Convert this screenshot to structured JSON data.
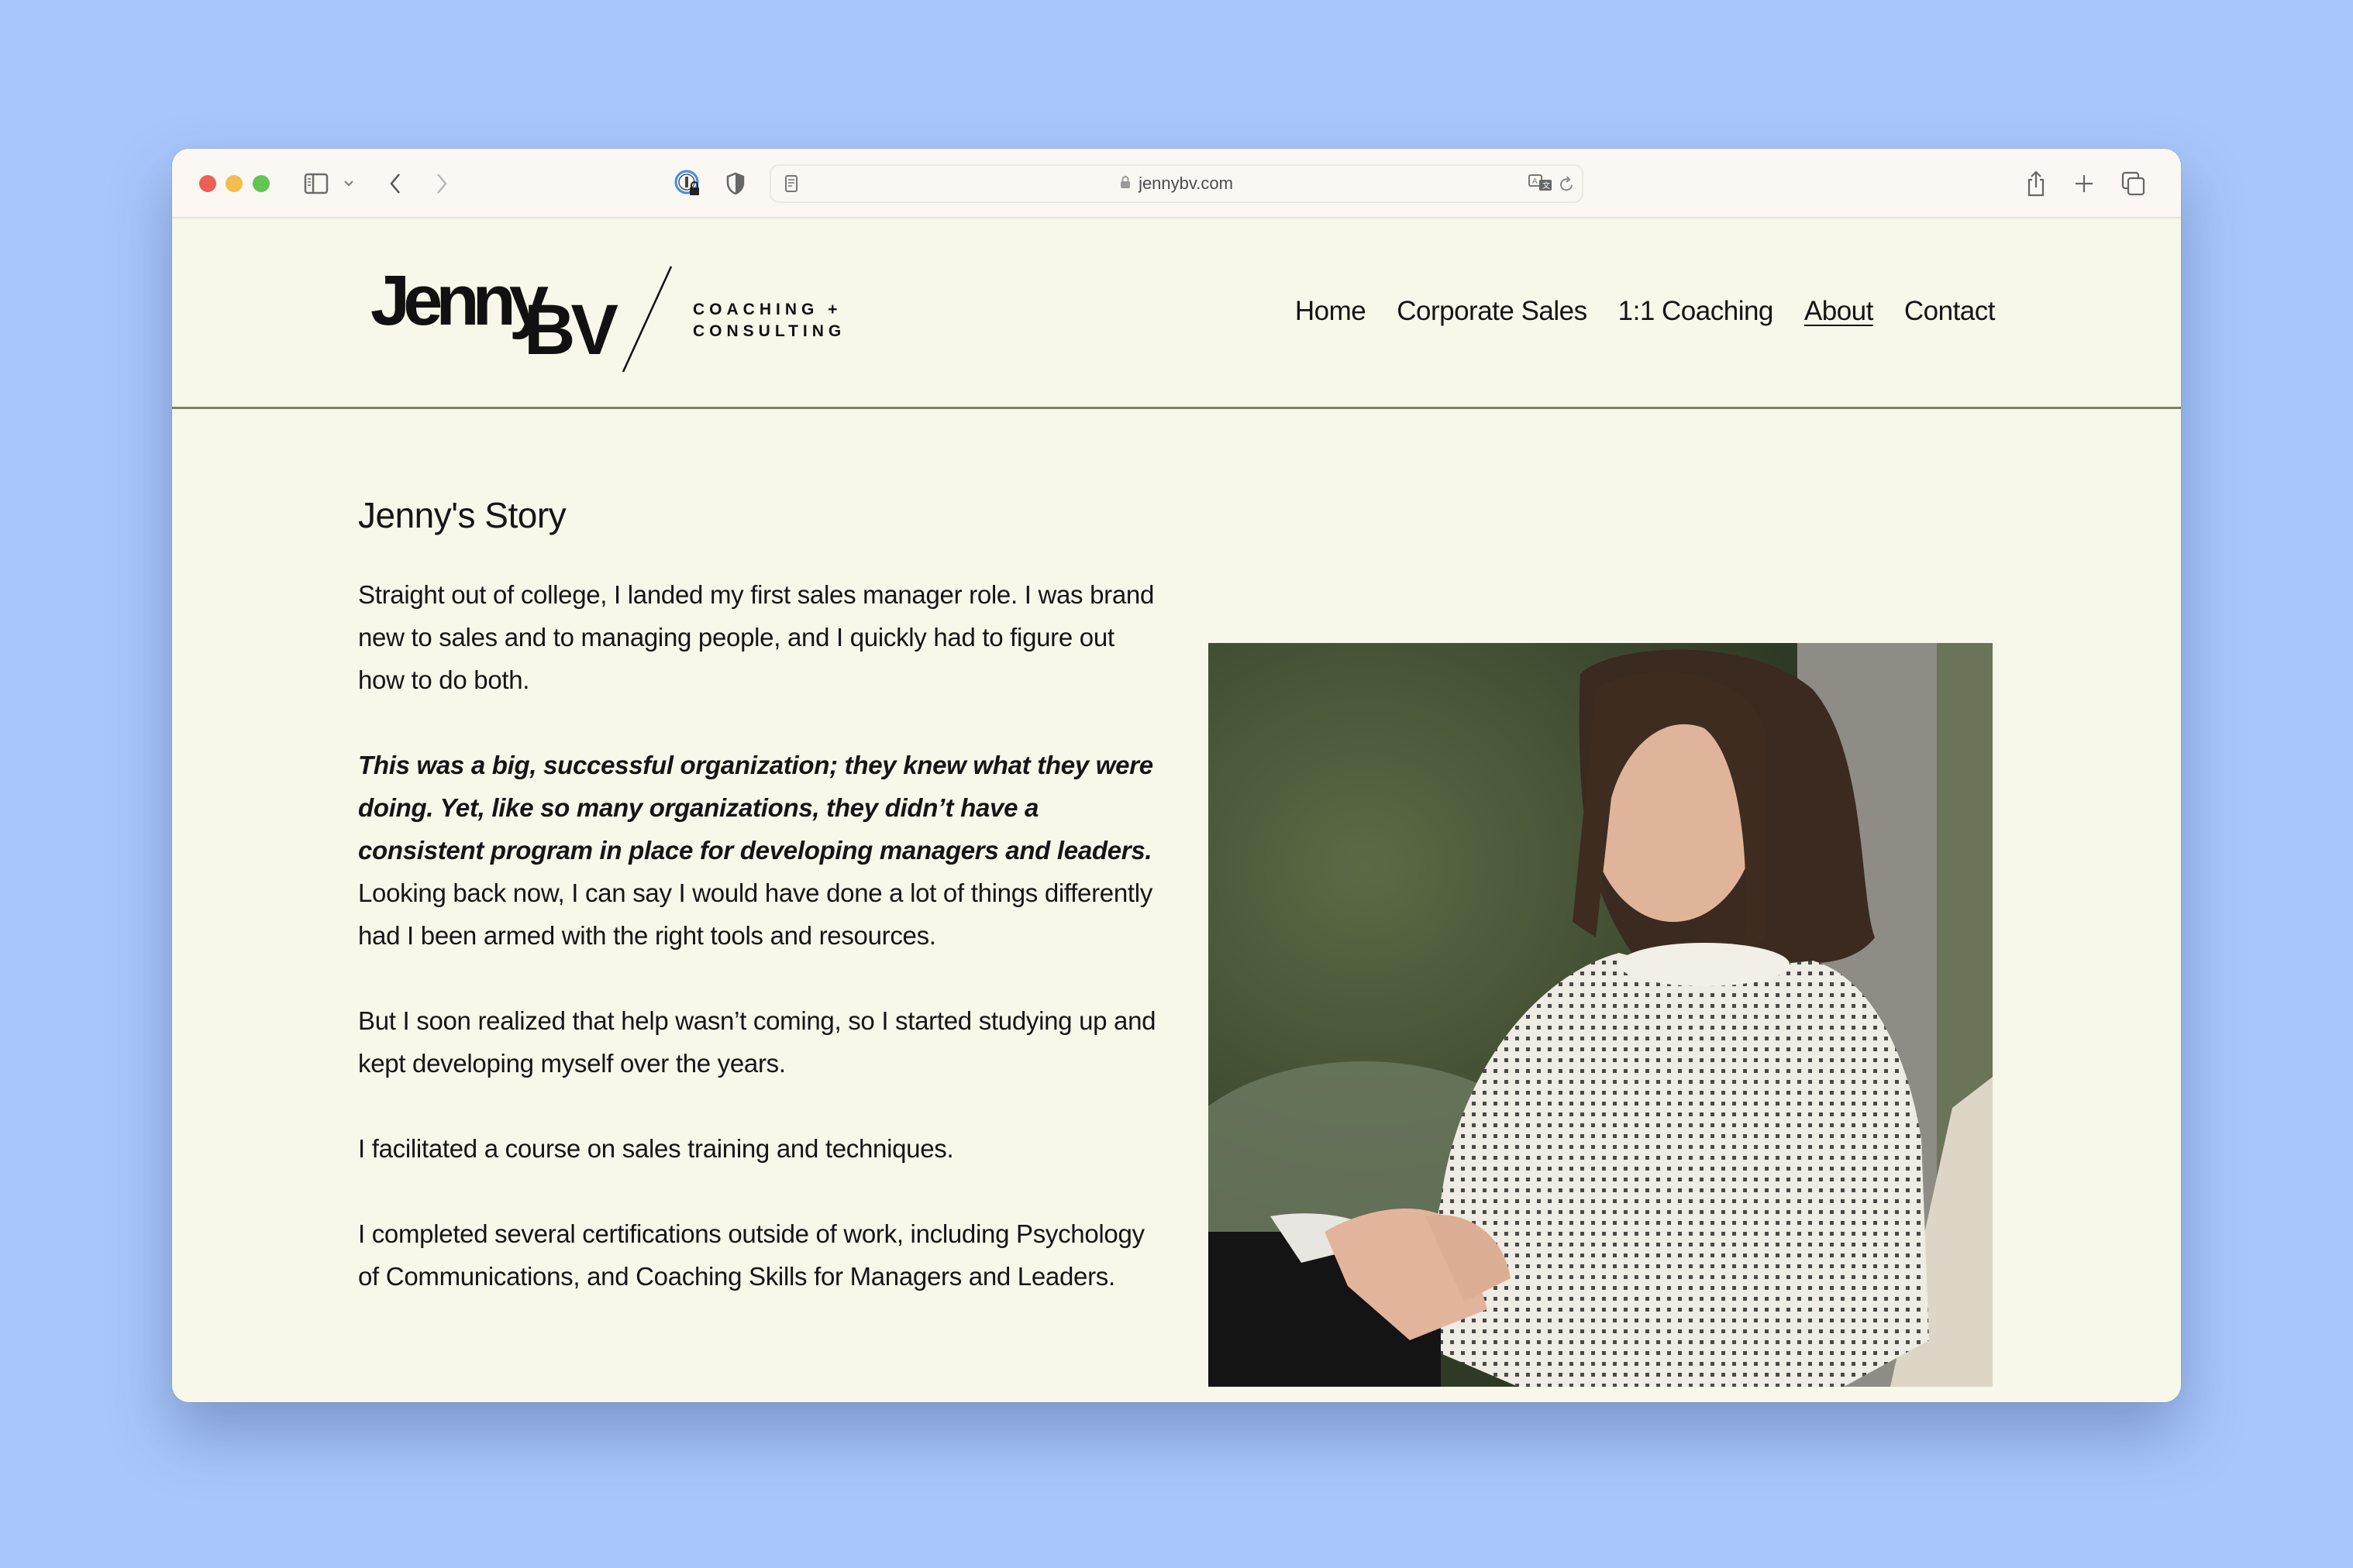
{
  "browser": {
    "url": "jennybv.com",
    "icons": {
      "sidebar": "sidebar-icon",
      "sidebar_menu": "chevron-down-icon",
      "back": "chevron-left-icon",
      "forward": "chevron-right-icon",
      "password": "password-manager-icon",
      "privacy": "shield-icon",
      "reader": "reader-icon",
      "lock": "lock-icon",
      "translate": "translate-icon",
      "reload": "reload-icon",
      "share": "share-icon",
      "new_tab": "plus-icon",
      "tabs": "tab-overview-icon"
    }
  },
  "site": {
    "logo": {
      "name_part1": "Jenny",
      "name_part2": "BV",
      "tagline_line1": "COACHING +",
      "tagline_line2": "CONSULTING"
    },
    "nav": [
      {
        "label": "Home",
        "active": false
      },
      {
        "label": "Corporate Sales",
        "active": false
      },
      {
        "label": "1:1 Coaching",
        "active": false
      },
      {
        "label": "About",
        "active": true
      },
      {
        "label": "Contact",
        "active": false
      }
    ]
  },
  "story": {
    "title": "Jenny's Story",
    "paragraphs": [
      {
        "bold_italic": "",
        "text": "Straight out of college, I landed my first sales manager role. I was brand new to sales and to managing people, and I quickly had to figure out how to do both."
      },
      {
        "bold_italic": "This was a big, successful organization; they knew what they were doing. Yet, like so many organizations, they didn’t have a consistent program in place for developing managers and leaders.",
        "text": " Looking back now, I can say I would have done a lot of things differently had I been armed with the right tools and resources."
      },
      {
        "bold_italic": "",
        "text": "But I soon realized that help wasn’t coming, so I started studying up and kept developing myself over the years."
      },
      {
        "bold_italic": "",
        "text": "I facilitated a course on sales training and techniques."
      },
      {
        "bold_italic": "",
        "text": "I completed several certifications outside of work, including Psychology of Communications, and Coaching Skills for Managers and Leaders."
      }
    ],
    "photo_alt": "Jenny smiling in a white knit sweater, petting a black and white dog outdoors"
  },
  "colors": {
    "desktop": "#a8c6fb",
    "page_bg": "#f7f7ea",
    "text": "#151515",
    "divider": "#7f8163"
  }
}
